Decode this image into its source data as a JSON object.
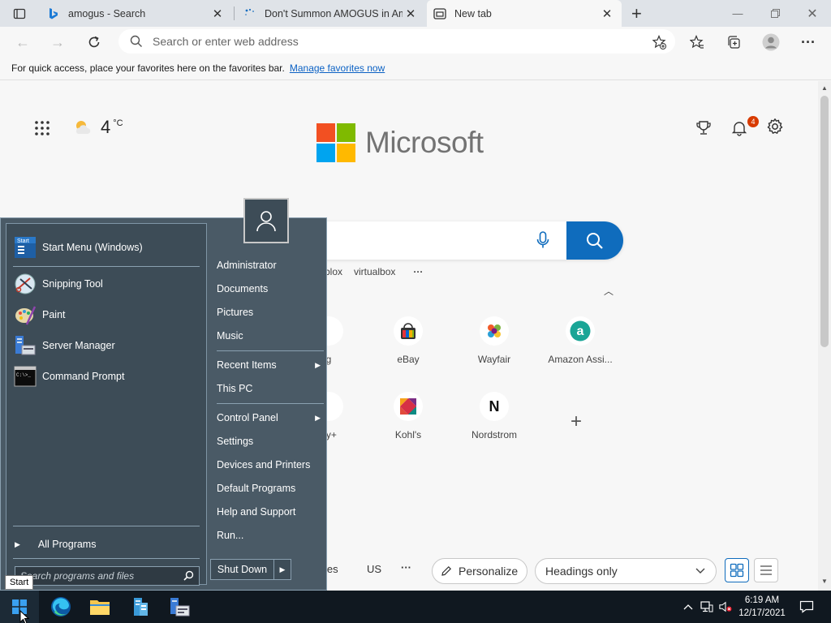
{
  "tabs": [
    {
      "title": "amogus - Search",
      "favicon": "bing-icon"
    },
    {
      "title": "Don't Summon AMOGUS in Among",
      "favicon": "loading-icon"
    },
    {
      "title": "New tab",
      "favicon": "newtab-icon"
    }
  ],
  "address": {
    "placeholder": "Search or enter web address"
  },
  "favbar": {
    "text": "For quick access, place your favorites here on the favorites bar.",
    "link": "Manage favorites now"
  },
  "newtab": {
    "weather_temp": "4",
    "weather_unit": "°C",
    "brand": "Microsoft",
    "notif_count": "4",
    "trending": [
      "blox",
      "virtualbox"
    ],
    "tiles_row1": [
      {
        "label": "g",
        "icon": "partial-icon"
      },
      {
        "label": "eBay",
        "icon": "ebay-icon"
      },
      {
        "label": "Wayfair",
        "icon": "wayfair-icon"
      },
      {
        "label": "Amazon Assi...",
        "icon": "amazon-assistant-icon"
      }
    ],
    "tiles_row2": [
      {
        "label": "ey+",
        "icon": "partial-icon"
      },
      {
        "label": "Kohl's",
        "icon": "kohls-icon"
      },
      {
        "label": "Nordstrom",
        "icon": "nordstrom-icon"
      }
    ],
    "feed": {
      "partial": "ies",
      "region": "US",
      "more": "···",
      "personalize": "Personalize",
      "headings": "Headings only"
    }
  },
  "startmenu": {
    "left_items": [
      {
        "label": "Start Menu (Windows)",
        "icon": "startmenu-icon"
      },
      {
        "label": "Snipping Tool",
        "icon": "snipping-tool-icon"
      },
      {
        "label": "Paint",
        "icon": "paint-icon"
      },
      {
        "label": "Server Manager",
        "icon": "server-manager-icon"
      },
      {
        "label": "Command Prompt",
        "icon": "cmd-icon"
      }
    ],
    "all_programs": "All Programs",
    "search_placeholder": "Search programs and files",
    "right_group1": [
      "Administrator",
      "Documents",
      "Pictures",
      "Music"
    ],
    "right_group2": [
      "Recent Items",
      "This PC"
    ],
    "right_group3": [
      "Control Panel",
      "Settings",
      "Devices and Printers",
      "Default Programs",
      "Help and Support",
      "Run..."
    ],
    "shutdown": "Shut Down",
    "icon_label": "Start"
  },
  "tooltip": "Start",
  "clock": {
    "time": "6:19 AM",
    "date": "12/17/2021"
  },
  "colors": {
    "accent": "#0f6cbd",
    "start_bg": "#4a5a66",
    "taskbar": "#101820"
  }
}
